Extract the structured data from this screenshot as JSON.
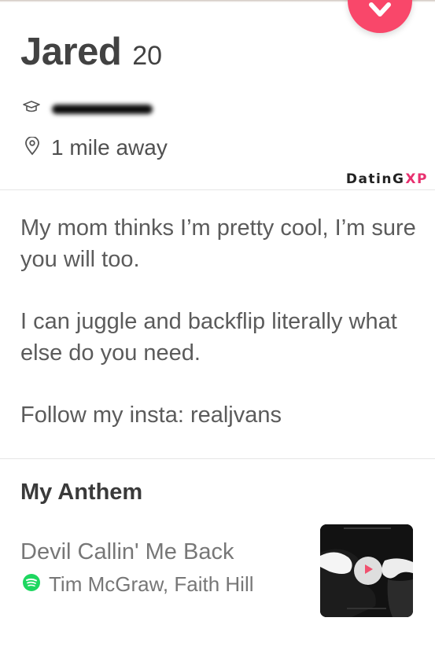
{
  "profile": {
    "name": "Jared",
    "age": "20",
    "distance": "1 mile away"
  },
  "watermark": {
    "main": "DatinG",
    "accent": "XP"
  },
  "bio": {
    "paragraphs": [
      "My mom thinks I’m pretty cool, I’m sure you will too.",
      "I can juggle and backflip literally what else do you need.",
      "Follow my insta: realjvans"
    ]
  },
  "anthem": {
    "section_title": "My Anthem",
    "song": "Devil Callin' Me Back",
    "artists": "Tim McGraw, Faith Hill"
  },
  "icons": {
    "dislike": "chevron-down-icon",
    "school": "graduation-cap-icon",
    "location": "location-pin-icon",
    "spotify": "spotify-icon",
    "play": "play-icon"
  },
  "colors": {
    "dislike_button": "#f9476a",
    "spotify_green": "#1ed760",
    "watermark_accent": "#e8306f",
    "play_icon": "#f0506e"
  }
}
